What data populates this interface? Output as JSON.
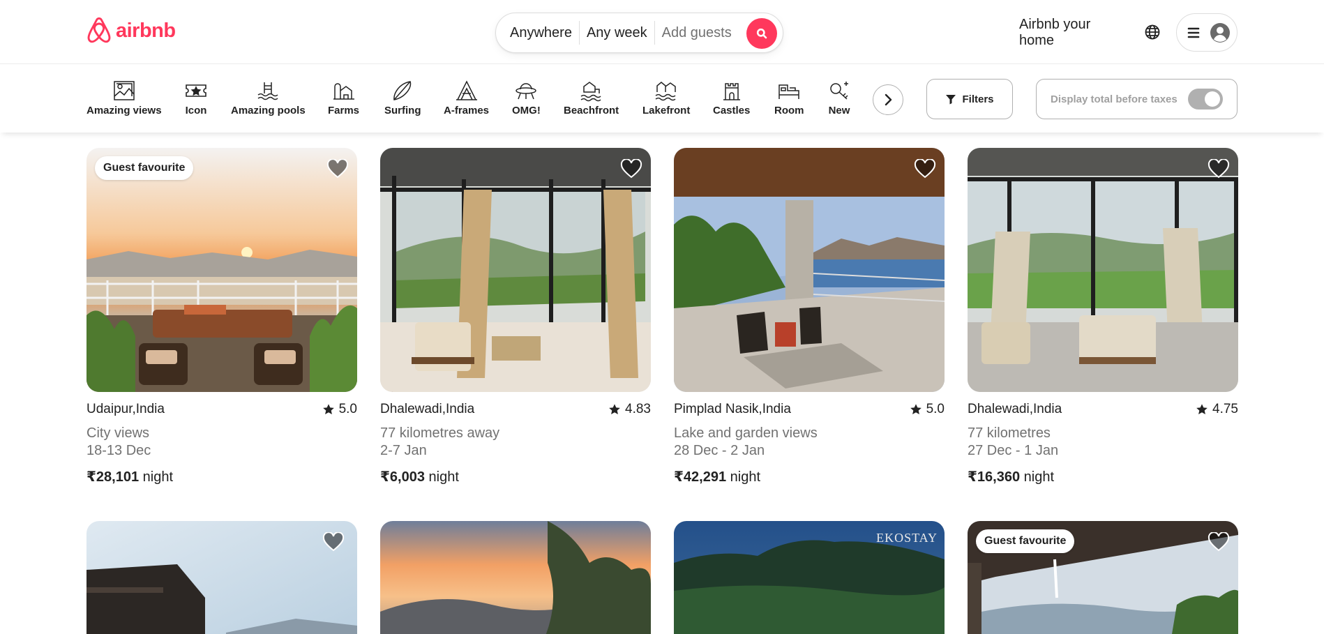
{
  "brand": {
    "name": "airbnb",
    "color": "#ff385c"
  },
  "search": {
    "location": "Anywhere",
    "dates": "Any week",
    "guests": "Add guests",
    "button_icon": "search-icon"
  },
  "header": {
    "host_link": "Airbnb your home",
    "globe_icon": "globe-icon",
    "menu_icon": "hamburger-icon",
    "avatar_icon": "user-avatar-icon"
  },
  "categories": [
    {
      "label": "Amazing views",
      "icon": "picture-frame-icon"
    },
    {
      "label": "Icon",
      "icon": "ticket-star-icon"
    },
    {
      "label": "Amazing pools",
      "icon": "pool-icon"
    },
    {
      "label": "Farms",
      "icon": "farm-icon"
    },
    {
      "label": "Surfing",
      "icon": "surfboard-icon"
    },
    {
      "label": "A-frames",
      "icon": "a-frame-icon"
    },
    {
      "label": "OMG!",
      "icon": "ufo-icon"
    },
    {
      "label": "Beachfront",
      "icon": "beach-icon"
    },
    {
      "label": "Lakefront",
      "icon": "lake-icon"
    },
    {
      "label": "Castles",
      "icon": "castle-icon"
    },
    {
      "label": "Room",
      "icon": "bed-icon"
    },
    {
      "label": "New",
      "icon": "sparkle-key-icon"
    }
  ],
  "filters": {
    "label": "Filters",
    "taxes_label": "Display total before taxes",
    "taxes_toggle_on": false
  },
  "listings": [
    {
      "location": "Udaipur,India",
      "rating": "5.0",
      "line1": "City views",
      "line2": "18-13 Dec",
      "price": "₹28,101",
      "unit": "night",
      "badge": "Guest favourite"
    },
    {
      "location": "Dhalewadi,India",
      "rating": "4.83",
      "line1": "77 kilometres away",
      "line2": "2-7 Jan",
      "price": "₹6,003",
      "unit": "night",
      "badge": ""
    },
    {
      "location": "Pimplad Nasik,India",
      "rating": "5.0",
      "line1": "Lake and garden views",
      "line2": "28 Dec - 2 Jan",
      "price": "₹42,291",
      "unit": "night",
      "badge": ""
    },
    {
      "location": "Dhalewadi,India",
      "rating": "4.75",
      "line1": "77 kilometres",
      "line2": "27 Dec - 1 Jan",
      "price": "₹16,360",
      "unit": "night",
      "badge": ""
    }
  ],
  "listings_row2": [
    {
      "badge": ""
    },
    {
      "badge": ""
    },
    {
      "badge": "",
      "watermark": "EKOSTAY"
    },
    {
      "badge": "Guest favourite"
    }
  ]
}
